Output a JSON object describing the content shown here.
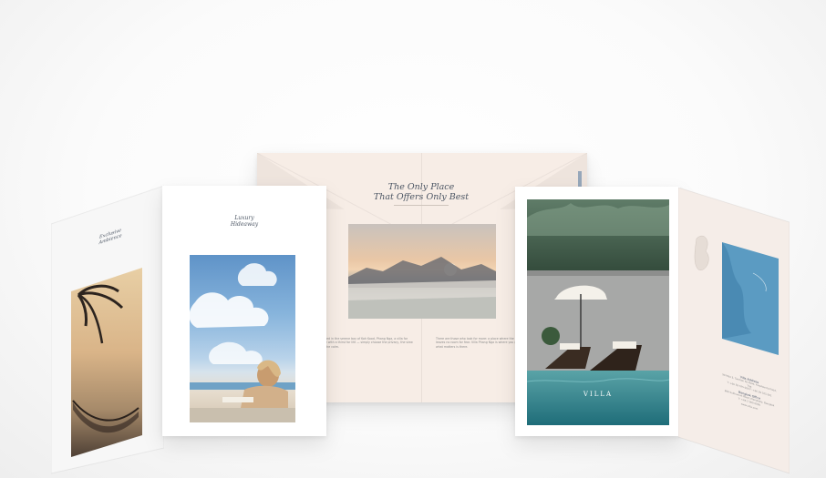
{
  "brochure_left": {
    "panel_title": "Exclusive\nAmbience",
    "inner_title": "Luxury\nHideaway",
    "colors": {
      "paper": "#ffffff",
      "inner": "#f9f9fb"
    }
  },
  "brochure_center": {
    "title_line1": "The Only Place",
    "title_line2": "That Offers Only Best",
    "left_paragraph": "Nestled in the serene bay of Koh Kood, Phang Nga, a villa for those with a thirst for life — simply choose the privacy, the view and the calm.",
    "right_paragraph": "There are those who look for more: a place where the heart leaves no room for fear. Villa Phang Nga is where you go when what matters is there.",
    "colors": {
      "paper": "#f7ede6",
      "title": "#44506a"
    }
  },
  "brochure_right": {
    "logo_text": "VILLA",
    "info_heading_1": "Villa Address",
    "info_line_1": "99 Moo 3, Tambon Ko Kood, Amphoe Ko Kood, Trat",
    "info_line_2": "T: +66 39 525 000   F: +66 39 525 001",
    "info_heading_2": "Bangkok Office",
    "info_line_3": "888 Sukhumvit Road, Klongtoey, Bangkok",
    "info_line_4": "T: +66 2 000 0000",
    "info_line_5": "www.villa.com",
    "colors": {
      "paper": "#f5ede8",
      "map_sea": "#5b9bc2"
    }
  },
  "icons": [
    "palm-photo-icon",
    "beach-photo-icon",
    "sunset-photo-icon",
    "pool-photo-icon",
    "map-icon"
  ]
}
